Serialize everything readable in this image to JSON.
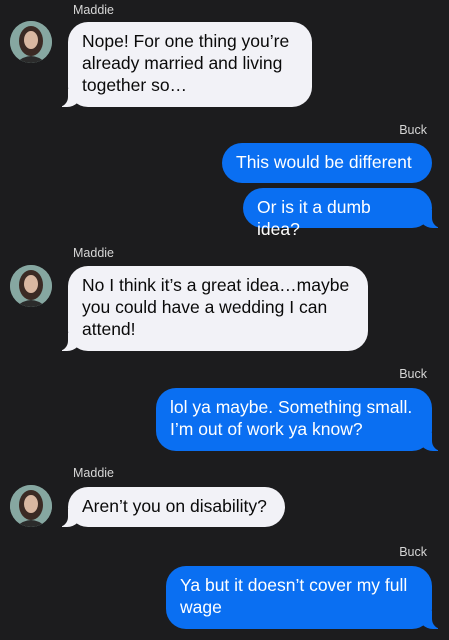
{
  "colors": {
    "background": "#1c1c1e",
    "incoming_bubble": "#f2f2f7",
    "outgoing_bubble": "#0a6ff2"
  },
  "contacts": {
    "other": "Maddie",
    "self": "Buck"
  },
  "messages": [
    {
      "sender": "Maddie",
      "direction": "incoming",
      "text": "Nope! For one thing you’re already married and living together so…"
    },
    {
      "sender": "Buck",
      "direction": "outgoing",
      "text": "This would be different"
    },
    {
      "sender": "Buck",
      "direction": "outgoing",
      "text": "Or is it a dumb idea?"
    },
    {
      "sender": "Maddie",
      "direction": "incoming",
      "text": "No I think it’s a great idea…maybe you could have a wedding I can attend!"
    },
    {
      "sender": "Buck",
      "direction": "outgoing",
      "text": "lol ya maybe. Something small. I’m out of work ya know?"
    },
    {
      "sender": "Maddie",
      "direction": "incoming",
      "text": "Aren’t you on disability?"
    },
    {
      "sender": "Buck",
      "direction": "outgoing",
      "text": "Ya but it doesn’t cover my full wage"
    }
  ]
}
